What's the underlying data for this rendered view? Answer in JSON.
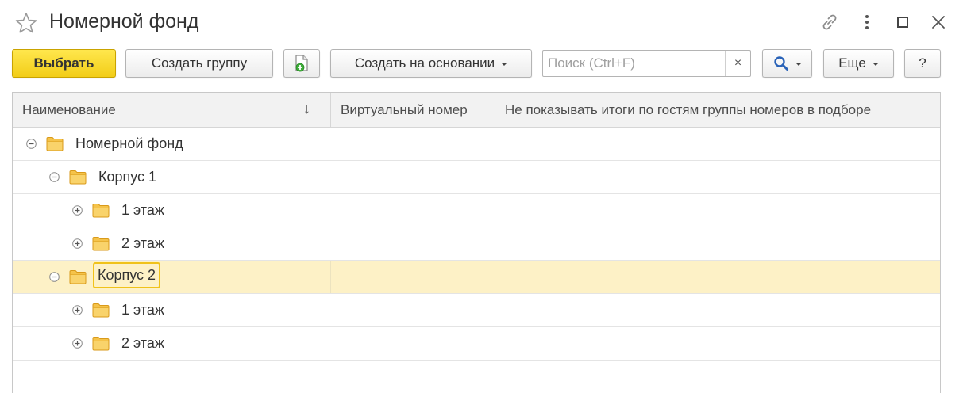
{
  "window": {
    "title": "Номерной фонд"
  },
  "toolbar": {
    "select_label": "Выбрать",
    "create_group_label": "Создать группу",
    "create_based_on_label": "Создать на основании",
    "search_placeholder": "Поиск (Ctrl+F)",
    "search_value": "",
    "clear_label": "×",
    "more_label": "Еще",
    "help_label": "?"
  },
  "table": {
    "columns": [
      {
        "label": "Наименование",
        "sort": "↓"
      },
      {
        "label": "Виртуальный номер"
      },
      {
        "label": "Не показывать итоги по гостям группы номеров в подборе"
      }
    ],
    "rows": [
      {
        "label": "Номерной фонд",
        "level": 0,
        "expanded": true,
        "selected": false
      },
      {
        "label": "Корпус 1",
        "level": 1,
        "expanded": true,
        "selected": false
      },
      {
        "label": "1 этаж",
        "level": 2,
        "expanded": false,
        "selected": false
      },
      {
        "label": "2 этаж",
        "level": 2,
        "expanded": false,
        "selected": false
      },
      {
        "label": "Корпус 2",
        "level": 1,
        "expanded": true,
        "selected": true
      },
      {
        "label": "1 этаж",
        "level": 2,
        "expanded": false,
        "selected": false
      },
      {
        "label": "2 этаж",
        "level": 2,
        "expanded": false,
        "selected": false
      }
    ]
  },
  "colors": {
    "primary_button": "#f5d423",
    "selected_row": "#fdf1c6",
    "focus_outline": "#f0c21a",
    "folder": "#f5c34a"
  },
  "icons": {
    "favorite": "star-icon",
    "link": "link-icon",
    "more": "kebab-menu-icon",
    "maximize": "maximize-icon",
    "close": "close-icon",
    "add_item": "document-add-icon",
    "search": "magnifier-icon",
    "expanded": "minus-circle-icon",
    "collapsed": "plus-circle-icon",
    "group": "folder-icon"
  }
}
